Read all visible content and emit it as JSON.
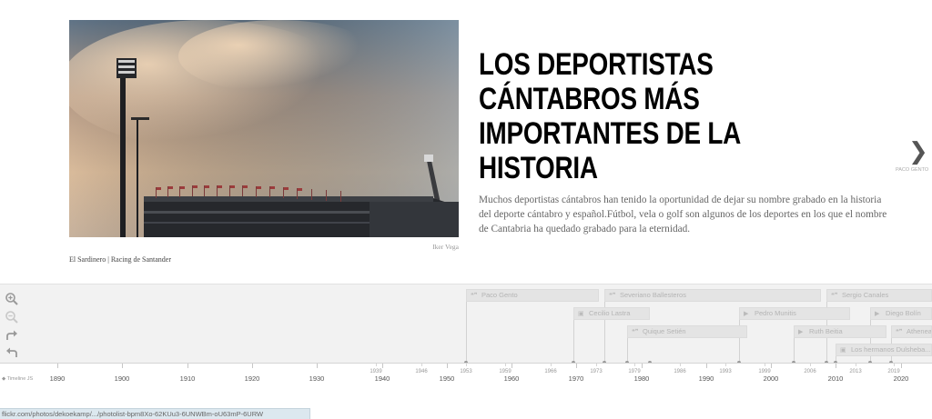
{
  "slide": {
    "headline": "LOS DEPORTISTAS CÁNTABROS MÁS IMPORTANTES DE LA HISTORIA",
    "text": "Muchos deportistas cántabros han tenido la oportunidad de dejar su nombre grabado en la historia del deporte cántabro y español.Fútbol, vela o golf son algunos de los deportes en los que el nombre de Cantabria ha quedado grabado para la eternidad.",
    "media_credit": "Iker Vega",
    "media_caption": "El Sardinero | Racing de Santander",
    "next_label": "PACO GENTO",
    "next_icon": "chevron-right-icon"
  },
  "timenav": {
    "tools": [
      "zoom-in-icon",
      "zoom-out-icon",
      "forward-icon",
      "back-icon"
    ],
    "brand": "Timeline JS",
    "markers": [
      {
        "label": "Paco Gento",
        "icon": "quote-icon"
      },
      {
        "label": "Severiano Ballesteros",
        "icon": "quote-icon"
      },
      {
        "label": "Sergio Canales",
        "icon": "quote-icon"
      },
      {
        "label": "Cecilio Lastra",
        "icon": "image-icon"
      },
      {
        "label": "Pedro Munitis",
        "icon": "video-icon"
      },
      {
        "label": "Diego Bolín",
        "icon": "video-icon"
      },
      {
        "label": "Quique Setién",
        "icon": "quote-icon"
      },
      {
        "label": "Ruth Beitia",
        "icon": "video-icon"
      },
      {
        "label": "Athenea",
        "icon": "quote-icon"
      },
      {
        "label": "Los hermanos Dulsheba...",
        "icon": "image-icon"
      }
    ],
    "major_years": [
      "1890",
      "1900",
      "1910",
      "1920",
      "1930",
      "1940",
      "1950",
      "1960",
      "1970",
      "1980",
      "1990",
      "2000",
      "2010",
      "2020"
    ],
    "minor_years": [
      "1939",
      "1946",
      "1953",
      "1959",
      "1966",
      "1973",
      "1979",
      "1986",
      "1993",
      "1999",
      "2006",
      "2013",
      "2019"
    ]
  },
  "statusbar": {
    "url": "flickr.com/photos/dekoekamp/.../photolist-bpm8Xo-62KUu3-6UNWBm-oU63mP-6URW"
  }
}
